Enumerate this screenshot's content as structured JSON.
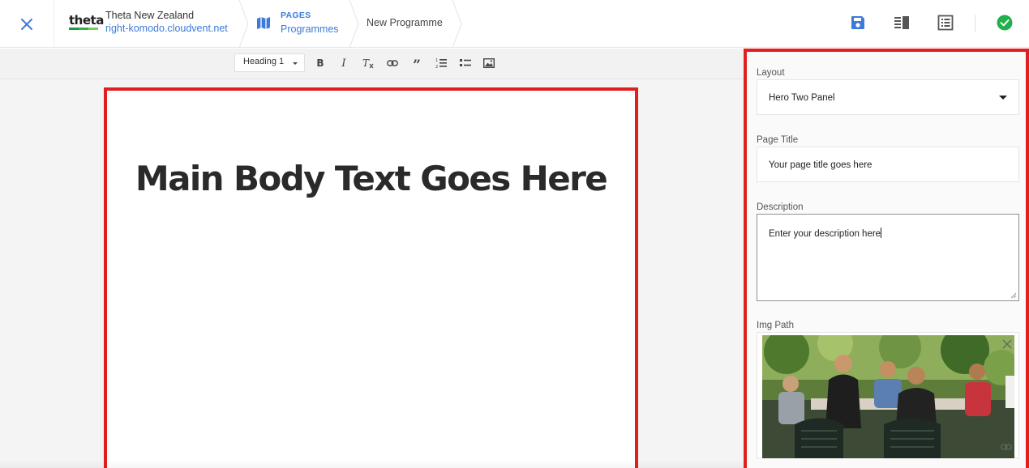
{
  "topbar": {
    "org_name": "Theta New Zealand",
    "org_url": "right-komodo.cloudvent.net",
    "logo_text": "theta",
    "breadcrumb_section": "PAGES",
    "breadcrumb_collection": "Programmes",
    "breadcrumb_current": "New Programme",
    "accent_color": "#3d7bd9",
    "icons": [
      "close-icon",
      "map-icon",
      "save-icon",
      "split-view-icon",
      "list-view-icon",
      "check-circle-icon"
    ]
  },
  "toolbar": {
    "heading_select": "Heading 1",
    "buttons": [
      "bold-icon",
      "italic-icon",
      "clear-format-icon",
      "link-icon",
      "quote-icon",
      "ordered-list-icon",
      "unordered-list-icon",
      "image-icon"
    ]
  },
  "editor": {
    "main_heading": "Main Body Text Goes Here"
  },
  "panel": {
    "layout": {
      "label": "Layout",
      "value": "Hero Two Panel"
    },
    "page_title": {
      "label": "Page Title",
      "value": "Your page title goes here"
    },
    "description": {
      "label": "Description",
      "value": "Enter your description here"
    },
    "img_path": {
      "label": "Img Path"
    }
  },
  "highlight_color": "#e0201f"
}
